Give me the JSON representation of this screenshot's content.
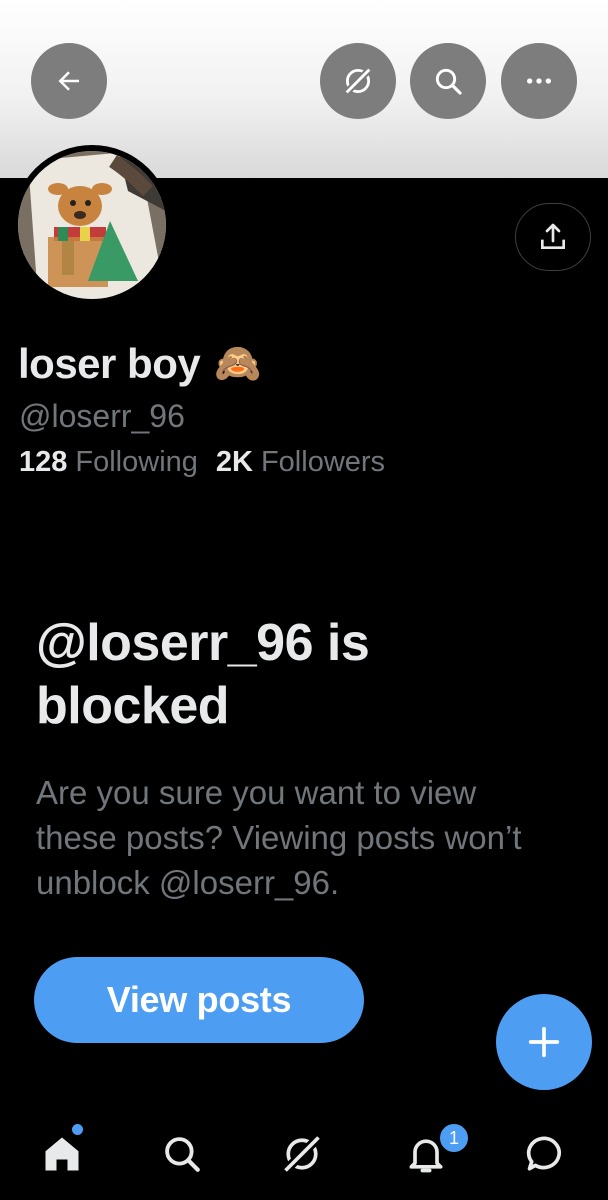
{
  "header": {
    "back_icon": "arrow-left-icon",
    "grok_icon": "grok-icon",
    "search_icon": "search-icon",
    "more_icon": "more-horizontal-icon",
    "share_icon": "share-icon"
  },
  "profile": {
    "display_name": "loser boy",
    "name_emoji": "🙈",
    "handle": "@loserr_96",
    "following_count": "128",
    "following_label": "Following",
    "followers_count": "2K",
    "followers_label": "Followers"
  },
  "blocked": {
    "title": "@loserr_96 is blocked",
    "description": "Are you sure you want to view these posts? Viewing posts won’t unblock @loserr_96.",
    "view_button": "View posts"
  },
  "tabbar": {
    "items": [
      "home-icon",
      "search-icon",
      "grok-icon",
      "notifications-icon",
      "messages-icon"
    ],
    "notification_badge": "1"
  },
  "colors": {
    "accent": "#4d9ef2",
    "background": "#000000",
    "muted_text": "#71767b",
    "primary_text": "#e7e9ea"
  }
}
